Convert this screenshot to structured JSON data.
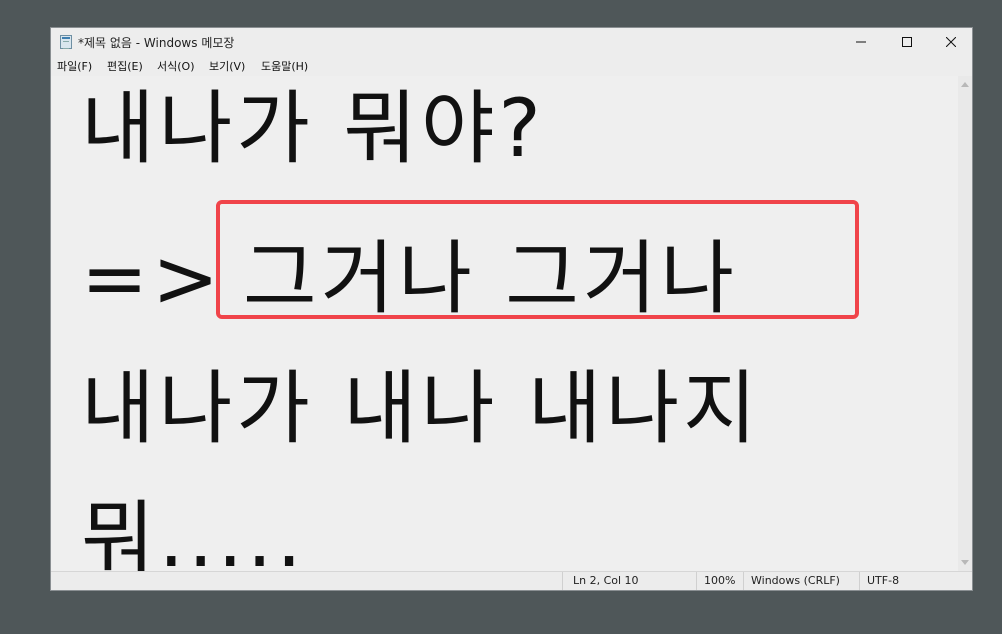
{
  "window": {
    "title": "*제목 없음 - Windows 메모장"
  },
  "menu": {
    "items": [
      {
        "label": "파일(F)"
      },
      {
        "label": "편집(E)"
      },
      {
        "label": "서식(O)"
      },
      {
        "label": "보기(V)"
      },
      {
        "label": "도움말(H)"
      }
    ]
  },
  "editor": {
    "line1": "내나가 뭐야?",
    "line2_prefix": "=>",
    "line2_highlight": "그거나 그거나",
    "line3": "내나가 내나 내나지",
    "line4": "뭐....."
  },
  "statusbar": {
    "position": "Ln 2, Col 10",
    "zoom": "100%",
    "line_ending": "Windows (CRLF)",
    "encoding": "UTF-8"
  },
  "colors": {
    "highlight_border": "#f0444a",
    "desktop": "#4f5759"
  },
  "icons": {
    "app": "notepad-icon",
    "minimize": "minimize-icon",
    "maximize": "maximize-icon",
    "close": "close-icon"
  }
}
